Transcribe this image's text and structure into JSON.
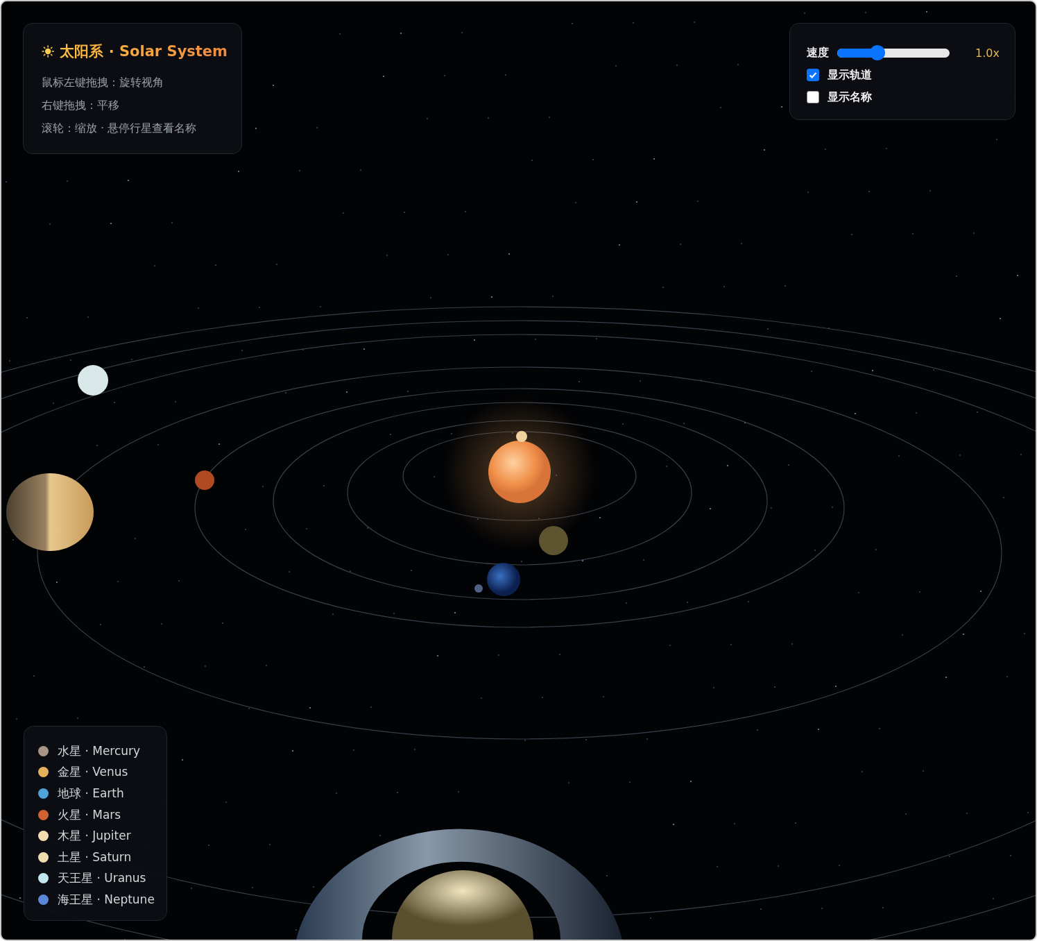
{
  "info_panel": {
    "title": "太阳系 · Solar System",
    "hints": [
      "鼠标左键拖拽：旋转视角",
      "右键拖拽：平移",
      "滚轮：缩放 · 悬停行星查看名称"
    ]
  },
  "controls": {
    "speed": {
      "label": "速度",
      "level": 0.36,
      "reading": "1.0x"
    },
    "toggles": [
      {
        "kind": "orbits",
        "label": "显示轨道",
        "checked": true
      },
      {
        "kind": "names",
        "label": "显示名称",
        "checked": false
      }
    ]
  },
  "legend": [
    {
      "name": "水星 · Mercury",
      "color": "#a89584"
    },
    {
      "name": "金星 · Venus",
      "color": "#e3b15a"
    },
    {
      "name": "地球 · Earth",
      "color": "#4fa3d9"
    },
    {
      "name": "火星 · Mars",
      "color": "#d2622f"
    },
    {
      "name": "木星 · Jupiter",
      "color": "#f3dcb0"
    },
    {
      "name": "土星 · Saturn",
      "color": "#f1dcae"
    },
    {
      "name": "天王星 · Uranus",
      "color": "#bfe8ee"
    },
    {
      "name": "海王星 · Neptune",
      "color": "#5b86d8"
    }
  ]
}
